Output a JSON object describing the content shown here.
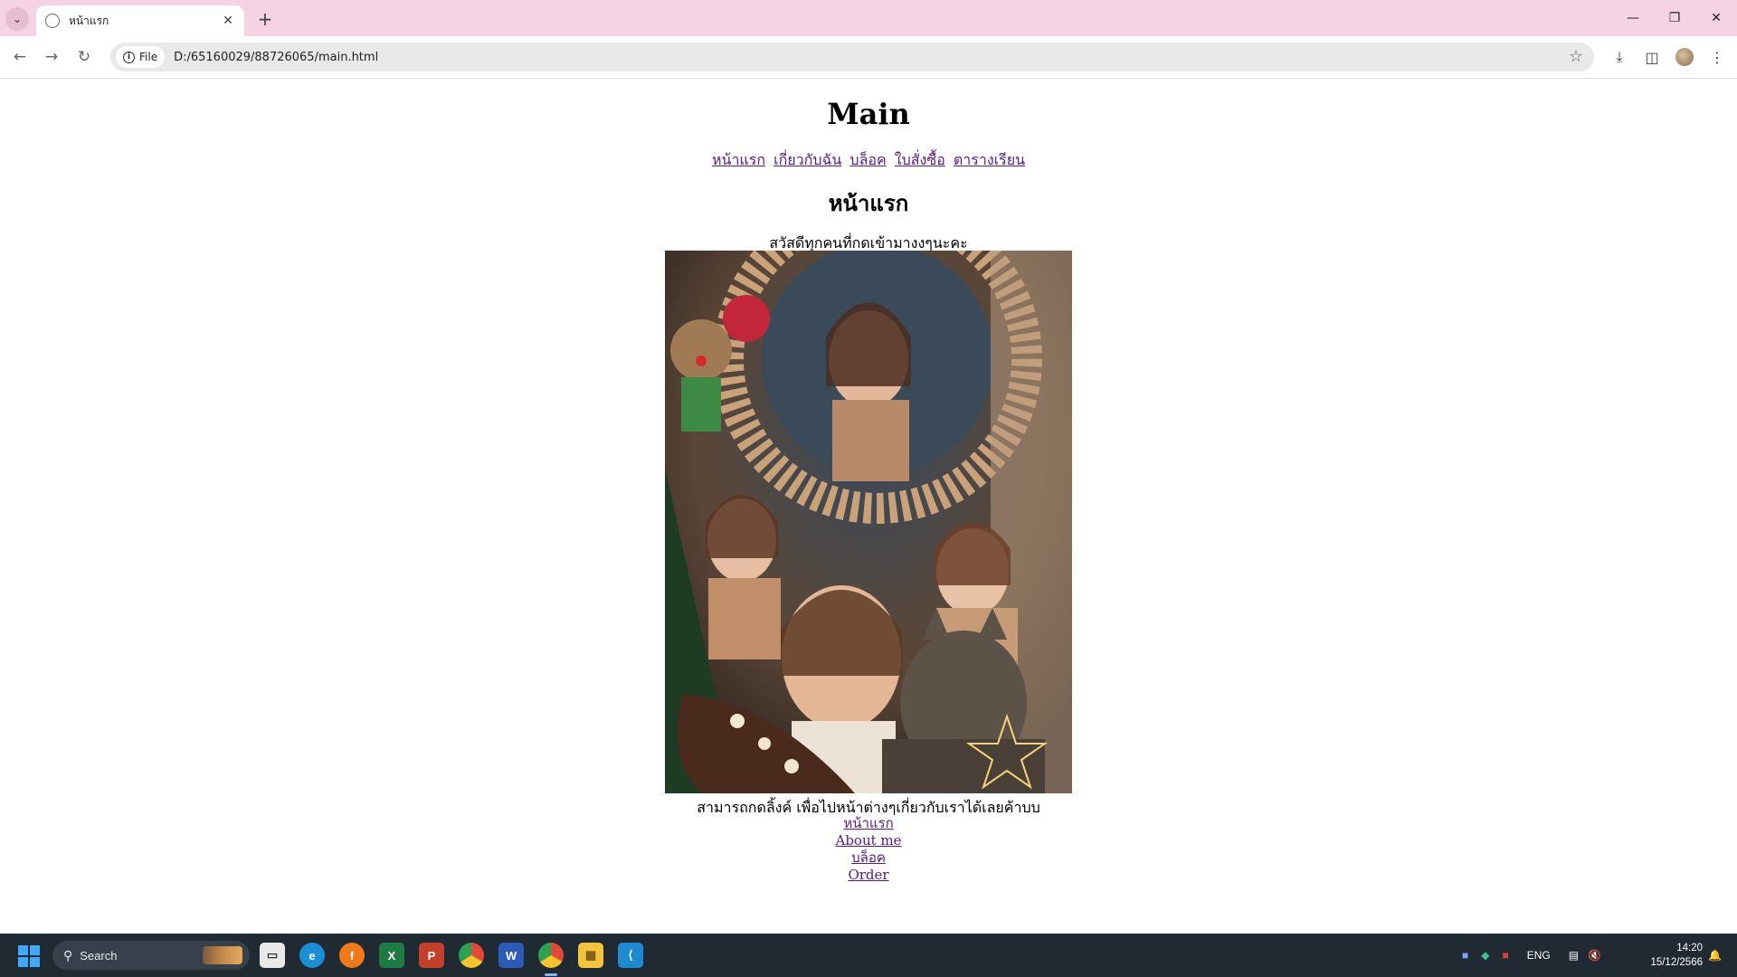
{
  "browser": {
    "tab_title": "หน้าแรก",
    "scheme_chip": "File",
    "url": "D:/65160029/88726065/main.html"
  },
  "page": {
    "heading": "Main",
    "nav": [
      "หน้าแรก",
      "เกี่ยวกับฉัน",
      "บล็อค",
      "ใบสั่งซื้อ",
      "ตารางเรียน"
    ],
    "section_heading": "หน้าแรก",
    "greeting": "สวัสดีทุกคนที่กดเข้ามางงๆนะคะ",
    "photo_icon": "collage-photo",
    "caption": "สามารถกดลิ้งค์ เพื่อไปหน้าต่างๆเกี่ยวกับเราได้เลยค้าบบ",
    "footer_links": [
      "หน้าแรก",
      "About me",
      "บล็อค",
      "Order"
    ]
  },
  "taskbar": {
    "search_placeholder": "Search",
    "lang": "ENG",
    "time": "14:20",
    "date": "15/12/2566"
  },
  "colors": {
    "tabbar": "#f5d3e3",
    "link_visited": "#551a8b",
    "taskbar": "#1f2a33"
  }
}
